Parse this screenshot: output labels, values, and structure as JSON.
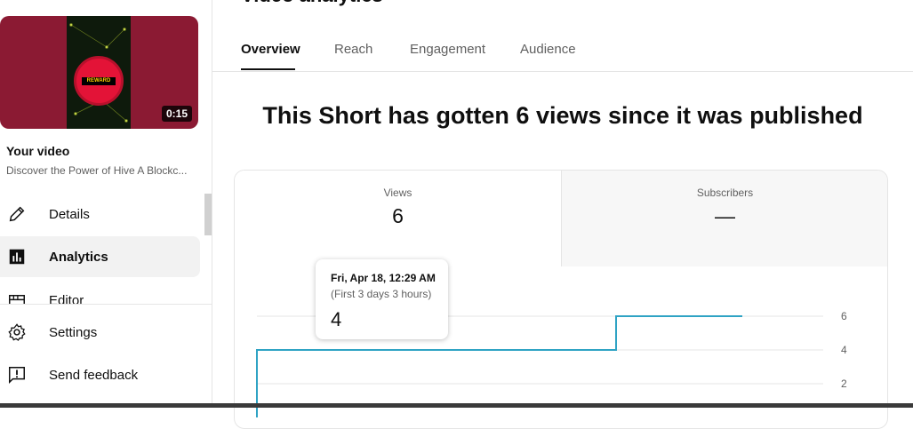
{
  "page": {
    "title": "Video analytics"
  },
  "sidebar": {
    "thumbnail": {
      "duration": "0:15",
      "badge_text": "REWARD"
    },
    "your_video_label": "Your video",
    "video_title": "Discover the Power of Hive A Blockc...",
    "items": [
      {
        "label": "Details",
        "icon": "pencil-icon"
      },
      {
        "label": "Analytics",
        "icon": "analytics-icon"
      },
      {
        "label": "Editor",
        "icon": "film-icon"
      },
      {
        "label": "Settings",
        "icon": "gear-icon"
      },
      {
        "label": "Send feedback",
        "icon": "feedback-icon"
      }
    ]
  },
  "tabs": [
    {
      "label": "Overview"
    },
    {
      "label": "Reach"
    },
    {
      "label": "Engagement"
    },
    {
      "label": "Audience"
    }
  ],
  "headline": "This Short has gotten 6 views since it was published",
  "metrics": {
    "views": {
      "label": "Views",
      "value": "6"
    },
    "subscribers": {
      "label": "Subscribers",
      "value": "—"
    }
  },
  "tooltip": {
    "date": "Fri, Apr 18, 12:29 AM",
    "subtitle": "(First 3 days 3 hours)",
    "value": "4"
  },
  "chart_data": {
    "type": "line",
    "y_ticks": [
      "6",
      "4",
      "2"
    ],
    "ylim": [
      0,
      6
    ],
    "series": [
      {
        "points": [
          [
            0,
            0
          ],
          [
            0,
            4
          ],
          [
            0.74,
            4
          ],
          [
            0.74,
            6
          ],
          [
            1.0,
            6
          ]
        ]
      }
    ],
    "colors": {
      "line": "#2fa3c4",
      "grid": "#e5e5e5"
    },
    "grid": true
  }
}
